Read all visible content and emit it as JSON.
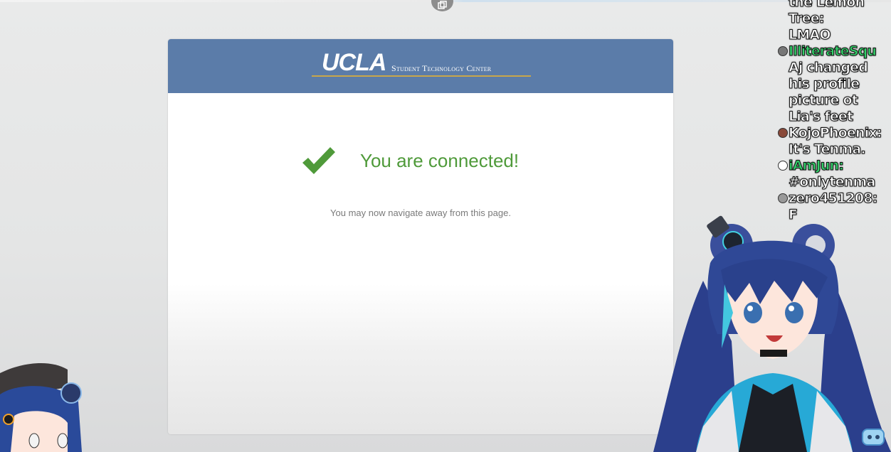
{
  "browser": {
    "screenshot_icon": "screenshot-icon"
  },
  "portal": {
    "logo_main": "UCLA",
    "logo_sub": "Student Technology Center",
    "status_icon": "checkmark-icon",
    "status_text": "You are connected!",
    "subtext": "You may now navigate away from this page.",
    "colors": {
      "header": "#5b7ca9",
      "success": "#4f9a3a",
      "logo_rule": "#c9a64a"
    }
  },
  "chat": {
    "messages": [
      {
        "lines": [
          "the Lemon",
          "Tree:",
          "LMAO"
        ]
      },
      {
        "user": "IlliterateSqu",
        "lines": [
          "Aj changed",
          "his profile",
          "picture ot",
          "Lia's feet"
        ]
      },
      {
        "user": "KojoPhoenix:",
        "lines": [
          "It's Tenma."
        ]
      },
      {
        "user": "iAmJun:",
        "lines": [
          "#onlytenma"
        ]
      },
      {
        "user": "zero451208:",
        "lines": [
          "F"
        ]
      }
    ]
  },
  "overlay": {
    "avatar_icon": "vtuber-avatar",
    "bot_icon": "bot-icon"
  }
}
